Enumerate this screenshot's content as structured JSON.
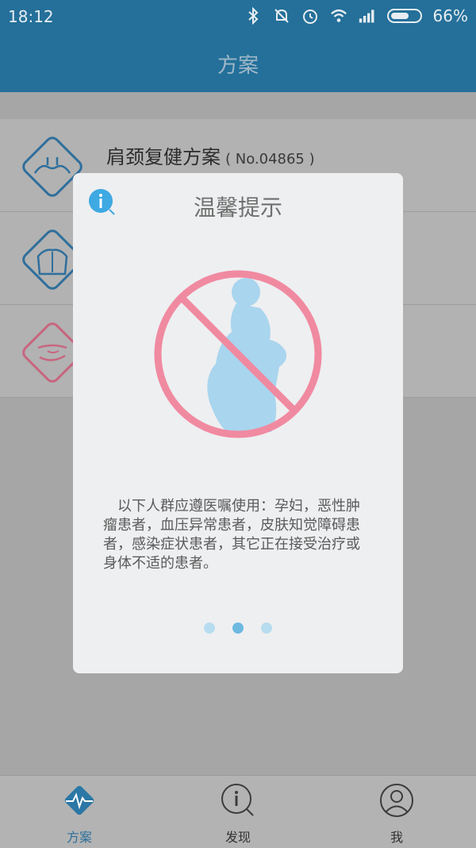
{
  "status": {
    "time": "18:12",
    "battery": "66%",
    "battery_level": 0.66
  },
  "header": {
    "title": "方案"
  },
  "list": {
    "items": [
      {
        "name": "肩颈复健方案",
        "code": "( No.04865 )",
        "icon": "shoulder-neck-icon"
      },
      {
        "name": "",
        "code": "",
        "icon": "back-icon"
      },
      {
        "name": "",
        "code": "",
        "icon": "abdomen-icon"
      }
    ]
  },
  "dialog": {
    "title": "温馨提示",
    "message": "以下人群应遵医嘱使用：孕妇，恶性肿瘤患者，血压异常患者，皮肤知觉障碍患者，感染症状患者，其它正在接受治疗或身体不适的患者。",
    "pages": 3,
    "active_page": 2,
    "icon": "info-icon",
    "illustration": "no-pregnant-woman-icon"
  },
  "tabs": [
    {
      "label": "方案",
      "icon": "heartbeat-icon",
      "active": true
    },
    {
      "label": "发现",
      "icon": "discover-icon",
      "active": false
    },
    {
      "label": "我",
      "icon": "user-icon",
      "active": false
    }
  ],
  "colors": {
    "primary": "#2879a6",
    "dialog_bg": "#eeeff1",
    "warning": "#f08aa1",
    "accent": "#6db9e1"
  }
}
